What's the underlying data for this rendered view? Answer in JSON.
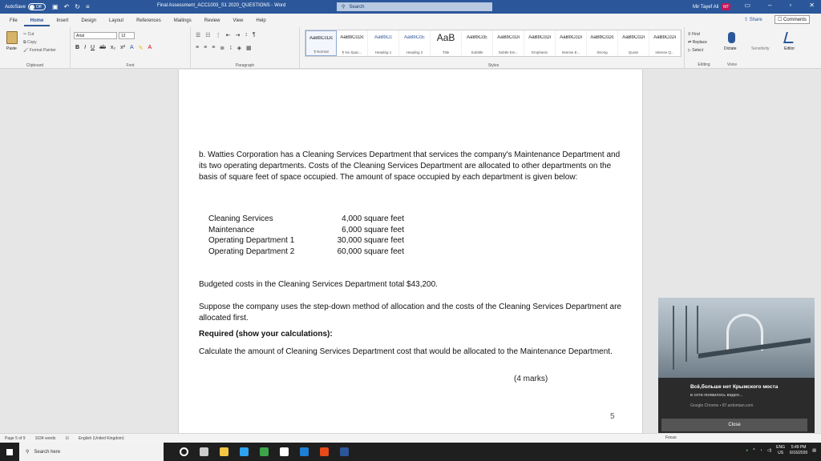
{
  "titlebar": {
    "autosave_label": "AutoSave",
    "autosave_state": "Off",
    "doc_title": "Final Assessment_ACC1003_S1 2020_QUESTIONS  -  Word",
    "search_placeholder": "Search",
    "user_name": "Mir Tayef Ali",
    "user_initials": "MT",
    "qat_icons": [
      "save-icon",
      "undo-icon",
      "redo-icon",
      "customize-icon"
    ]
  },
  "menu": {
    "tabs": [
      "File",
      "Home",
      "Insert",
      "Design",
      "Layout",
      "References",
      "Mailings",
      "Review",
      "View",
      "Help"
    ],
    "active_tab": "Home",
    "share_label": "Share",
    "comments_label": "Comments"
  },
  "ribbon": {
    "clipboard": {
      "paste": "Paste",
      "cut": "Cut",
      "copy": "Copy",
      "format_painter": "Format Painter",
      "label": "Clipboard"
    },
    "font": {
      "name": "Arial",
      "size": "12",
      "label": "Font"
    },
    "paragraph": {
      "label": "Paragraph"
    },
    "styles": {
      "label": "Styles",
      "items": [
        {
          "sample": "AaBbCcDc",
          "name": "¶ Normal"
        },
        {
          "sample": "AaBbCcDc",
          "name": "¶ No Spac..."
        },
        {
          "sample": "AaBbCc",
          "name": "Heading 1"
        },
        {
          "sample": "AaBbCcE",
          "name": "Heading 2"
        },
        {
          "sample": "AaB",
          "name": "Title"
        },
        {
          "sample": "AaBbCcE",
          "name": "Subtitle"
        },
        {
          "sample": "AaBbCcDi",
          "name": "Subtle Em..."
        },
        {
          "sample": "AaBbCcDi",
          "name": "Emphasis"
        },
        {
          "sample": "AaBbCcDi",
          "name": "Intense E..."
        },
        {
          "sample": "AaBbCcDc",
          "name": "Strong"
        },
        {
          "sample": "AaBbCcDi",
          "name": "Quote"
        },
        {
          "sample": "AaBbCcDi",
          "name": "Intense Q..."
        }
      ]
    },
    "editing": {
      "find": "Find",
      "replace": "Replace",
      "select": "Select",
      "label": "Editing"
    },
    "voice": {
      "dictate": "Dictate",
      "label": "Voice"
    },
    "sensitivity": {
      "label": "Sensitivity"
    },
    "editor": {
      "label": "Editor"
    }
  },
  "document": {
    "intro": "b. Watties Corporation has a Cleaning Services Department that services the company's Maintenance Department and its two operating departments. Costs of the Cleaning Services Department are allocated to other departments on the basis of square feet of space occupied. The amount of space occupied by each department is given below:",
    "table": [
      {
        "name": "Cleaning Services",
        "value": "4,000 square feet"
      },
      {
        "name": "Maintenance",
        "value": "6,000 square feet"
      },
      {
        "name": "Operating Department 1",
        "value": "30,000 square feet"
      },
      {
        "name": "Operating Department 2",
        "value": "60,000 square feet"
      }
    ],
    "budget": "Budgeted costs in the Cleaning Services Department total $43,200.",
    "suppose": "Suppose the company uses the step-down method of allocation and the costs of the Cleaning Services Department are allocated first.",
    "required": "Required (show your calculations):",
    "task": "Calculate the amount of Cleaning Services Department cost that would be allocated to the Maintenance Department.",
    "marks": "(4 marks)",
    "page_number": "5"
  },
  "notification": {
    "title": "Всё,больше нет Крымского моста",
    "subtitle": "в сети появилось видео...",
    "source": "Google Chrome • 87.ardomian.com",
    "close_label": "Close",
    "focus_label": "Focus"
  },
  "statusbar": {
    "page": "Page 5 of 9",
    "words": "1034 words",
    "language": "English (United Kingdom)"
  },
  "taskbar": {
    "search_placeholder": "Search here",
    "apps": [
      {
        "name": "cortana",
        "color": "#ffffff"
      },
      {
        "name": "task-view",
        "color": "#cccccc"
      },
      {
        "name": "file-explorer",
        "color": "#f3c744"
      },
      {
        "name": "store",
        "color": "#2ea3f2"
      },
      {
        "name": "chrome",
        "color": "#3ea44c"
      },
      {
        "name": "dropbox",
        "color": "#ffffff"
      },
      {
        "name": "edge",
        "color": "#1e7fd6"
      },
      {
        "name": "office",
        "color": "#e64a19"
      },
      {
        "name": "word",
        "color": "#2b579a"
      }
    ],
    "lang": "ENG",
    "region": "US",
    "time": "5:49 PM",
    "date": "6/16/2020"
  }
}
